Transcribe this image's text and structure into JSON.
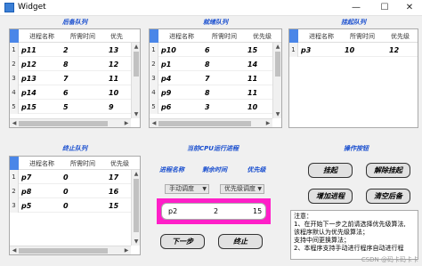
{
  "window": {
    "title": "Widget",
    "minimize": "—",
    "maximize": "☐",
    "close": "✕"
  },
  "sections": {
    "backup": "后备队列",
    "ready": "就绪队列",
    "suspended": "挂起队列",
    "terminated": "终止队列",
    "running": "当前CPU运行进程",
    "ops": "操作按钮"
  },
  "backup_table": {
    "headers": [
      "进程名称",
      "所需时间",
      "优先"
    ],
    "rows": [
      {
        "n": "1",
        "name": "p11",
        "time": "2",
        "prio": "13"
      },
      {
        "n": "2",
        "name": "p12",
        "time": "8",
        "prio": "12"
      },
      {
        "n": "3",
        "name": "p13",
        "time": "7",
        "prio": "11"
      },
      {
        "n": "4",
        "name": "p14",
        "time": "6",
        "prio": "10"
      },
      {
        "n": "5",
        "name": "p15",
        "time": "5",
        "prio": "9"
      }
    ]
  },
  "ready_table": {
    "headers": [
      "进程名称",
      "所需时间",
      "优先级"
    ],
    "rows": [
      {
        "n": "1",
        "name": "p10",
        "time": "6",
        "prio": "15"
      },
      {
        "n": "2",
        "name": "p1",
        "time": "8",
        "prio": "14"
      },
      {
        "n": "3",
        "name": "p4",
        "time": "7",
        "prio": "11"
      },
      {
        "n": "4",
        "name": "p9",
        "time": "8",
        "prio": "11"
      },
      {
        "n": "5",
        "name": "p6",
        "time": "3",
        "prio": "10"
      }
    ]
  },
  "suspended_table": {
    "headers": [
      "进程名称",
      "所需时间",
      "优先级"
    ],
    "rows": [
      {
        "n": "1",
        "name": "p3",
        "time": "10",
        "prio": "12"
      }
    ]
  },
  "terminated_table": {
    "headers": [
      "进程名称",
      "所需时间",
      "优先级"
    ],
    "rows": [
      {
        "n": "1",
        "name": "p7",
        "time": "0",
        "prio": "17"
      },
      {
        "n": "2",
        "name": "p8",
        "time": "0",
        "prio": "16"
      },
      {
        "n": "3",
        "name": "p5",
        "time": "0",
        "prio": "15"
      }
    ]
  },
  "running": {
    "col_name": "进程名称",
    "col_time": "剩余时间",
    "col_prio": "优先级",
    "mode_combo": "手动调度",
    "algo_combo": "优先级调度",
    "proc_name": "p2",
    "proc_time": "2",
    "proc_prio": "15"
  },
  "buttons": {
    "suspend": "挂起",
    "unsuspend": "解除挂起",
    "add": "增加进程",
    "clear_backup": "清空后备",
    "next": "下一步",
    "stop": "终止"
  },
  "notes": [
    "注意：",
    "1、在开始下一步之前请选择优先级算法,",
    "该程序默认为优先级算法；",
    "支持中间更换算法；",
    "2、本程序支持手动进行程序自动进行程"
  ],
  "watermark": "CSDN @码卡码卡卡",
  "colors": {
    "accent": "#1a4fcf",
    "highlight": "#ff1fc8",
    "header_corner": "#4a86e8"
  }
}
